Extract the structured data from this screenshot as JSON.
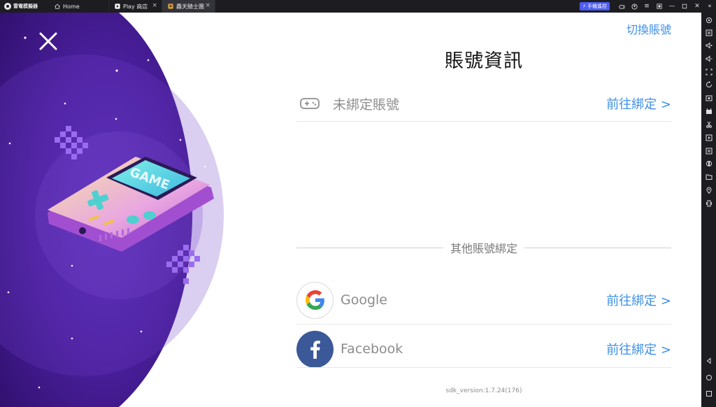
{
  "titlebar": {
    "brand": "雷電模擬器",
    "tabs": [
      {
        "label": "Home",
        "icon": "home-icon",
        "active": false
      },
      {
        "label": "Play 商店",
        "icon": "play-store-icon",
        "active": false
      },
      {
        "label": "轟天騎士團",
        "icon": "game-app-icon",
        "active": true
      }
    ],
    "remote_button": "手機遙控",
    "accent_color": "#4c5cf0"
  },
  "game": {
    "switch_account": "切換賬號",
    "title": "賬號資訊",
    "unbound_label": "未綁定賬號",
    "bind_link": "前往綁定 >",
    "other_section": "其他賬號綁定",
    "providers": [
      {
        "name": "Google",
        "bind_link": "前往綁定 >",
        "icon": "google-icon"
      },
      {
        "name": "Facebook",
        "bind_link": "前往綁定 >",
        "icon": "facebook-icon",
        "color": "#3b5998"
      }
    ],
    "sdk_version": "sdk_version:1.7.24(176)",
    "link_color": "#3d8fe6",
    "art_text": "GAME"
  },
  "sidebar": {
    "items": [
      "settings-icon",
      "keyboard-icon",
      "volume-up-icon",
      "volume-down-icon",
      "screenshot-icon",
      "rotate-icon",
      "record-icon",
      "apk-icon",
      "cut-icon",
      "macro-icon",
      "sync-icon",
      "multi-instance-icon",
      "folder-icon",
      "location-icon",
      "shake-icon",
      "back-icon",
      "home-nav-icon",
      "recent-apps-icon"
    ]
  }
}
